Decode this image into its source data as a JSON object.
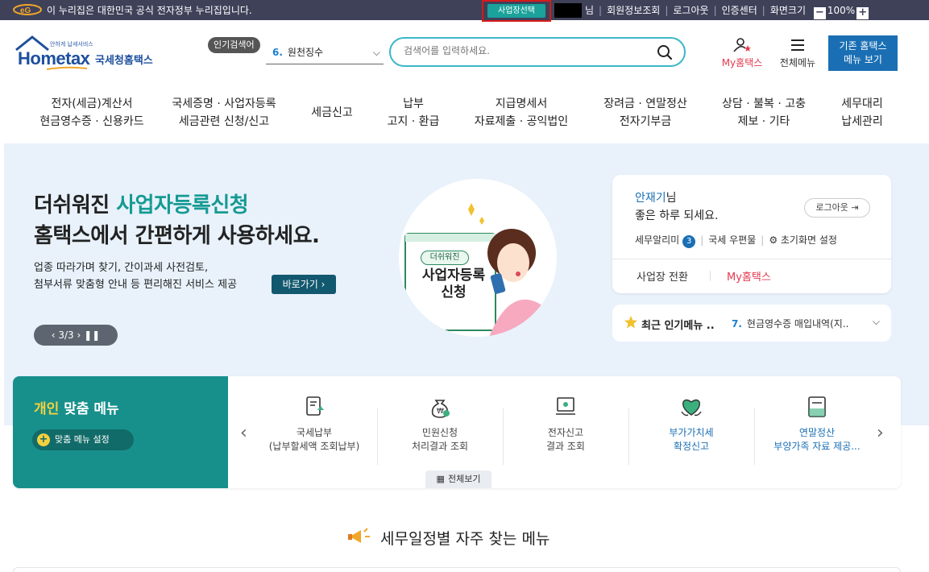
{
  "gov_bar": {
    "notice": "이 누리집은 대한민국 공식 전자정부 누리집입니다.",
    "biz_select": "사업장선택",
    "user_suffix": "님",
    "links": [
      "회원정보조회",
      "로그아웃",
      "인증센터",
      "화면크기"
    ],
    "zoom_minus": "−",
    "zoom_level": "100%",
    "zoom_plus": "+"
  },
  "header": {
    "logo_small": "안하게 납세서비스",
    "logo_main": "Hometax",
    "logo_kr": "국세청홈택스",
    "popular_badge": "인기검색어",
    "popular_rank": "6.",
    "popular_term": "원천징수",
    "search_placeholder": "검색어를 입력하세요.",
    "my_hometax": "My홈택스",
    "all_menu": "전체메뉴",
    "old_hometax_line1": "기존 홈택스",
    "old_hometax_line2": "메뉴 보기"
  },
  "gnb": [
    {
      "line1": "전자(세금)계산서",
      "line2": "현금영수증 · 신용카드"
    },
    {
      "line1": "국세증명 · 사업자등록",
      "line2": "세금관련 신청/신고"
    },
    {
      "line1": "세금신고",
      "line2": ""
    },
    {
      "line1": "납부",
      "line2": "고지 · 환급"
    },
    {
      "line1": "지급명세서",
      "line2": "자료제출 · 공익법인"
    },
    {
      "line1": "장려금 · 연말정산",
      "line2": "전자기부금"
    },
    {
      "line1": "상담 · 불복 · 고충",
      "line2": "제보 · 기타"
    },
    {
      "line1": "세무대리",
      "line2": "납세관리"
    }
  ],
  "hero": {
    "title_pre": "더쉬워진 ",
    "title_accent": "사업자등록신청",
    "title_line2": "홈택스에서 간편하게 사용하세요.",
    "desc_line1": "업종 따라가며 찾기, 간이과세 사전검토,",
    "desc_line2": "첨부서류 맞춤형 안내 등 편리해진 서비스 제공",
    "go_button": "바로가기 ›",
    "pager": "‹  3/3  ›   ❚❚",
    "illus_badge": "더쉬워진",
    "illus_title_line1": "사업자등록",
    "illus_title_line2": "신청"
  },
  "login_card": {
    "name": "안재기",
    "name_suffix": "님",
    "greeting": "좋은 하루 되세요.",
    "logout": "로그아웃 ⇥",
    "alerts_label": "세무알리미",
    "alerts_count": "3",
    "mailbox": "국세 우편물",
    "reset_screen": "⚙ 초기화면 설정",
    "switch_biz": "사업장 전환",
    "my_hometax": "My홈택스"
  },
  "recent": {
    "title": "최근 인기메뉴 ..",
    "rank": "7.",
    "item": "현금영수증 매입내역(지.."
  },
  "custom_menu": {
    "title_accent": "개인",
    "title_rest": " 맞춤 메뉴",
    "settings": "맞춤 메뉴 설정",
    "items": [
      {
        "line1": "국세납부",
        "line2": "(납부할세액 조회납부)",
        "icon": "tax-payment-icon"
      },
      {
        "line1": "민원신청",
        "line2": "처리결과 조회",
        "icon": "money-bag-icon"
      },
      {
        "line1": "전자신고",
        "line2": "결과 조회",
        "icon": "e-filing-icon"
      },
      {
        "line1": "부가가치세",
        "line2": "확정신고",
        "icon": "vat-heart-icon"
      },
      {
        "line1": "연말정산",
        "line2": "부양가족 자료 제공...",
        "icon": "year-end-icon"
      }
    ],
    "see_all": "전체보기",
    "prev": "‹",
    "next": "›"
  },
  "schedule": {
    "title": "세무일정별 자주 찾는 메뉴"
  },
  "colors": {
    "gov_bar": "#3f4159",
    "teal": "#17908c",
    "accent_green": "#159a93",
    "hero_bg": "#e9f2fb",
    "brand_blue": "#1a6fb4",
    "my_red": "#e23a4e"
  }
}
